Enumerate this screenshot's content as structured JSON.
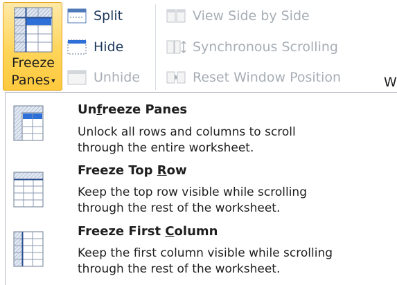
{
  "ribbon": {
    "freeze_panes": {
      "line1": "Freeze",
      "line2": "Panes",
      "caret": "▾",
      "icon": "freeze-panes-icon"
    },
    "split": {
      "label": "Split",
      "icon": "split-icon",
      "enabled": true
    },
    "hide": {
      "label": "Hide",
      "icon": "hide-window-icon",
      "enabled": true
    },
    "unhide": {
      "label": "Unhide",
      "icon": "unhide-window-icon",
      "enabled": false
    },
    "view_side_by_side": {
      "label": "View Side by Side",
      "icon": "side-by-side-icon",
      "enabled": false
    },
    "synchronous_scrolling": {
      "label": "Synchronous Scrolling",
      "icon": "sync-scroll-icon",
      "enabled": false
    },
    "reset_window_position": {
      "label": "Reset Window Position",
      "icon": "reset-window-icon",
      "enabled": false
    },
    "cut_off_letter": "W"
  },
  "menu": {
    "items": [
      {
        "title": "Unfreeze Panes",
        "accelerator": "f",
        "description_line1": "Unlock all rows and columns to scroll",
        "description_line2": "through the entire worksheet.",
        "icon": "unfreeze-panes-icon"
      },
      {
        "title": "Freeze Top Row",
        "accelerator": "R",
        "description_line1": "Keep the top row visible while scrolling",
        "description_line2": "through the rest of the worksheet.",
        "icon": "freeze-top-row-icon"
      },
      {
        "title": "Freeze First Column",
        "accelerator": "C",
        "description_line1": "Keep the first column visible while scrolling",
        "description_line2": "through the rest of the worksheet.",
        "icon": "freeze-first-column-icon"
      }
    ]
  },
  "colors": {
    "highlight_fill": "#ffd55a",
    "highlight_border": "#e3a21a",
    "text_enabled": "#1e395b",
    "text_disabled": "#a7adb5"
  }
}
